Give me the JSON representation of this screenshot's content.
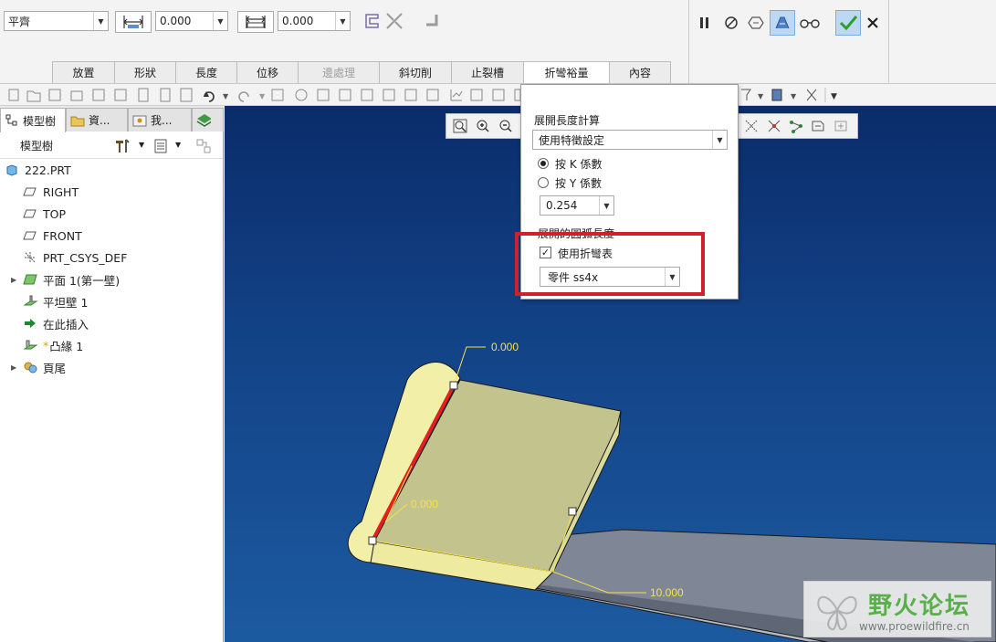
{
  "dashboard": {
    "shape_type": "平齊",
    "length_value": "0.000",
    "offset_value": "0.000",
    "tabs": [
      {
        "label": "放置",
        "state": "normal"
      },
      {
        "label": "形狀",
        "state": "normal"
      },
      {
        "label": "長度",
        "state": "normal"
      },
      {
        "label": "位移",
        "state": "normal"
      },
      {
        "label": "邊處理",
        "state": "disabled"
      },
      {
        "label": "斜切削",
        "state": "normal"
      },
      {
        "label": "止裂槽",
        "state": "normal"
      },
      {
        "label": "折彎裕量",
        "state": "active"
      },
      {
        "label": "內容",
        "state": "normal"
      }
    ],
    "controls": {
      "pause": "pause-icon",
      "cancel_preview": "no-preview-icon",
      "preview": "preview-icon",
      "verify": "verify-icon",
      "glasses": "glasses-icon",
      "ok": "check-icon",
      "cancel": "close-icon"
    }
  },
  "left_panel": {
    "tabs": [
      {
        "label": "模型樹",
        "icon": "model-tree-icon"
      },
      {
        "label": "資...",
        "icon": "folder-browser-icon"
      },
      {
        "label": "我...",
        "icon": "favorites-icon"
      },
      {
        "label": "",
        "icon": "layer-icon"
      }
    ],
    "tree_header_label": "模型樹",
    "tree": [
      {
        "label": "222.PRT",
        "icon": "part-icon",
        "level": 0,
        "expandable": false
      },
      {
        "label": "RIGHT",
        "icon": "datum-plane-icon",
        "level": 1,
        "expandable": false
      },
      {
        "label": "TOP",
        "icon": "datum-plane-icon",
        "level": 1,
        "expandable": false
      },
      {
        "label": "FRONT",
        "icon": "datum-plane-icon",
        "level": 1,
        "expandable": false
      },
      {
        "label": "PRT_CSYS_DEF",
        "icon": "csys-icon",
        "level": 1,
        "expandable": false
      },
      {
        "label": "平面 1(第一壁)",
        "icon": "planar-wall-icon",
        "level": 1,
        "expandable": true
      },
      {
        "label": "平坦壁 1",
        "icon": "flat-wall-icon",
        "level": 1,
        "expandable": false
      },
      {
        "label": "在此插入",
        "icon": "insert-here-icon",
        "level": 1,
        "expandable": false
      },
      {
        "label": "凸緣 1",
        "icon": "flange-icon",
        "level": 1,
        "expandable": false,
        "marker": "*"
      },
      {
        "label": "頁尾",
        "icon": "footer-icon",
        "level": 1,
        "expandable": true
      }
    ]
  },
  "popup": {
    "section1_title": "展開長度計算",
    "calc_method": "使用特徵設定",
    "radio_k": "按 K 係數",
    "radio_y": "按 Y 係數",
    "factor_value": "0.254",
    "section2_title": "展開的圓弧長度",
    "use_bend_table": "使用折彎表",
    "bend_table_value": "零件 ss4x"
  },
  "model": {
    "dim_top": "0.000",
    "dim_mid": "0.000",
    "dim_length": "10.000"
  },
  "watermark": {
    "title": "野火论坛",
    "url": "www.proewildfire.cn"
  },
  "colors": {
    "graphics_bg_top": "#0a2c6a",
    "graphics_bg_bottom": "#1c5aa0",
    "flange_face": "#c3c48d",
    "flange_side": "#f2f0a8",
    "base_wall": "#7f8796",
    "dimension": "#f4e24a",
    "highlight_edge": "#e61e1e",
    "annotation_box": "#d0202a",
    "ok_green": "#2e9e2e",
    "watermark_green": "#59b04a"
  }
}
